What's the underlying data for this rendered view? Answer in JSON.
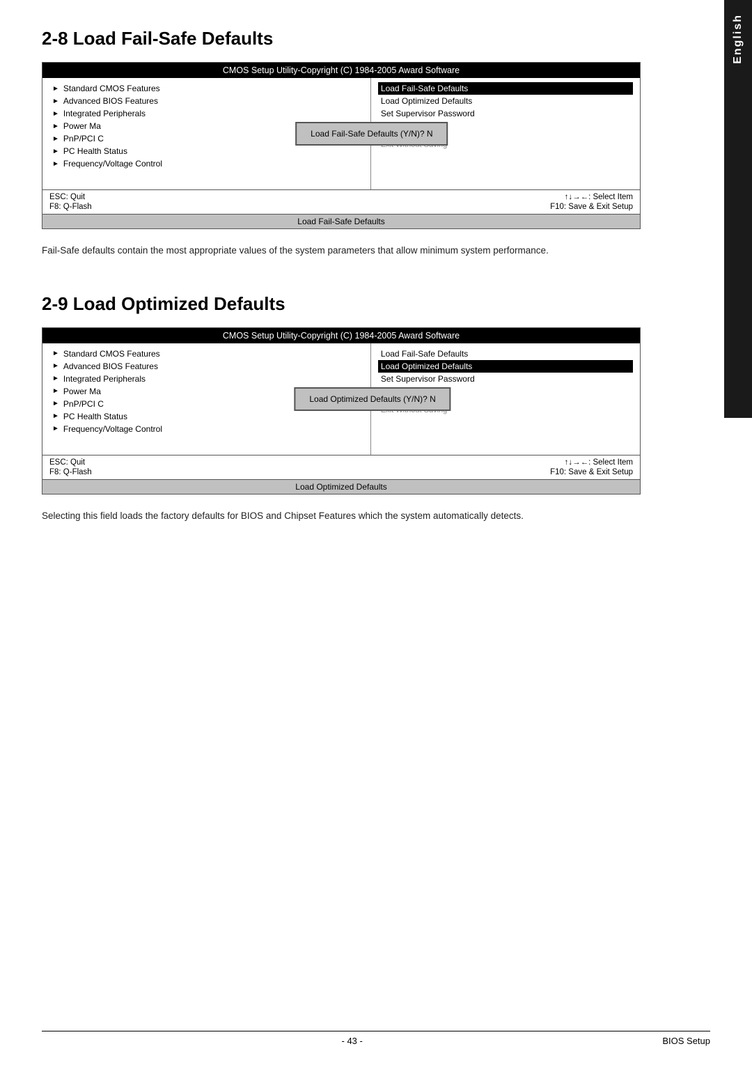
{
  "page": {
    "footer": {
      "page_number": "- 43 -",
      "right_label": "BIOS Setup"
    }
  },
  "side_tab": {
    "label": "English"
  },
  "section_28": {
    "heading": "2-8    Load Fail-Safe Defaults",
    "bios": {
      "title": "CMOS Setup Utility-Copyright (C) 1984-2005 Award Software",
      "left_menu": [
        "Standard CMOS Features",
        "Advanced BIOS Features",
        "Integrated Peripherals",
        "Power Ma",
        "PnP/PCI C",
        "PC Health Status",
        "Frequency/Voltage Control"
      ],
      "right_menu": [
        {
          "label": "Load Fail-Safe Defaults",
          "selected": true
        },
        {
          "label": "Load Optimized Defaults",
          "selected": false
        },
        {
          "label": "Set Supervisor Password",
          "selected": false
        },
        {
          "label": "",
          "selected": false
        },
        {
          "label": "",
          "selected": false
        },
        {
          "label": "Exit Without Saving",
          "selected": false
        }
      ],
      "dialog": "Load Fail-Safe Defaults (Y/N)? N",
      "footer_left": [
        "ESC: Quit",
        "F8: Q-Flash"
      ],
      "footer_right": [
        "↑↓→←: Select Item",
        "F10: Save & Exit Setup"
      ],
      "bottom_bar": "Load Fail-Safe Defaults"
    },
    "description": "Fail-Safe defaults contain the most appropriate values of the system parameters that allow minimum system performance."
  },
  "section_29": {
    "heading": "2-9    Load Optimized Defaults",
    "bios": {
      "title": "CMOS Setup Utility-Copyright (C) 1984-2005 Award Software",
      "left_menu": [
        "Standard CMOS Features",
        "Advanced BIOS Features",
        "Integrated Peripherals",
        "Power Ma",
        "PnP/PCI C",
        "PC Health Status",
        "Frequency/Voltage Control"
      ],
      "right_menu": [
        {
          "label": "Load Fail-Safe Defaults",
          "selected": false
        },
        {
          "label": "Load Optimized Defaults",
          "selected": true
        },
        {
          "label": "Set Supervisor Password",
          "selected": false
        },
        {
          "label": "",
          "selected": false
        },
        {
          "label": "",
          "selected": false
        },
        {
          "label": "Exit Without Saving",
          "selected": false
        }
      ],
      "dialog": "Load Optimized Defaults (Y/N)? N",
      "footer_left": [
        "ESC: Quit",
        "F8: Q-Flash"
      ],
      "footer_right": [
        "↑↓→←: Select Item",
        "F10: Save & Exit Setup"
      ],
      "bottom_bar": "Load Optimized Defaults"
    },
    "description": "Selecting this field loads the factory defaults for BIOS and Chipset Features which the system automatically detects."
  }
}
